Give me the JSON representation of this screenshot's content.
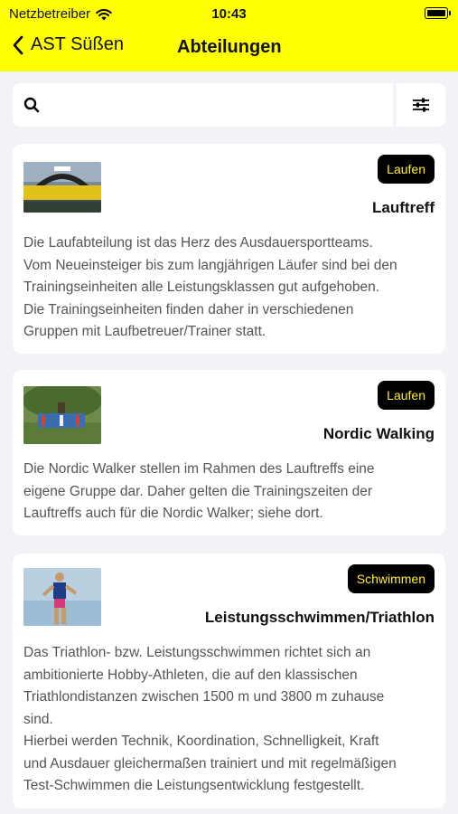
{
  "status_bar": {
    "carrier": "Netzbetreiber",
    "time": "10:43"
  },
  "nav": {
    "back_label": "AST Süßen",
    "title": "Abteilungen"
  },
  "search": {
    "placeholder": ""
  },
  "cards": [
    {
      "badge": "Laufen",
      "title": "Lauftreff",
      "description": "Die Laufabteilung ist das Herz des Ausdauersportteams.\nVom Neueinsteiger bis zum langjährigen Läufer sind bei den\nTrainingseinheiten alle Leistungsklassen gut aufgehoben.\nDie Trainingseinheiten finden daher in verschiedenen\nGruppen mit Laufbetreuer/Trainer statt."
    },
    {
      "badge": "Laufen",
      "title": "Nordic Walking",
      "description": "Die Nordic Walker stellen im Rahmen des Lauftreffs eine\neigene Gruppe dar. Daher gelten die Trainingszeiten der\nLauftreffs auch für die Nordic Walker; siehe dort."
    },
    {
      "badge": "Schwimmen",
      "title": "Leistungsschwimmen/Triathlon",
      "description": "Das Triathlon- bzw. Leistungsschwimmen richtet sich an\nambitionierte Hobby-Athleten, die auf den klassischen\nTriathlondistanzen zwischen 1500 m und 3800 m zuhause\nsind.\nHierbei werden Technik, Koordination, Schnelligkeit, Kraft\nund Ausdauer gleichermaßen trainiert und mit regelmäßigen\nTest-Schwimmen die Leistungsentwicklung festgestellt."
    }
  ],
  "colors": {
    "accent": "#ffff00",
    "badge_bg": "#000000",
    "badge_text": "#ffef2a",
    "background": "#f2f2f7"
  },
  "icons": [
    "wifi-icon",
    "battery-icon",
    "chevron-left-icon",
    "search-icon",
    "filter-icon"
  ]
}
